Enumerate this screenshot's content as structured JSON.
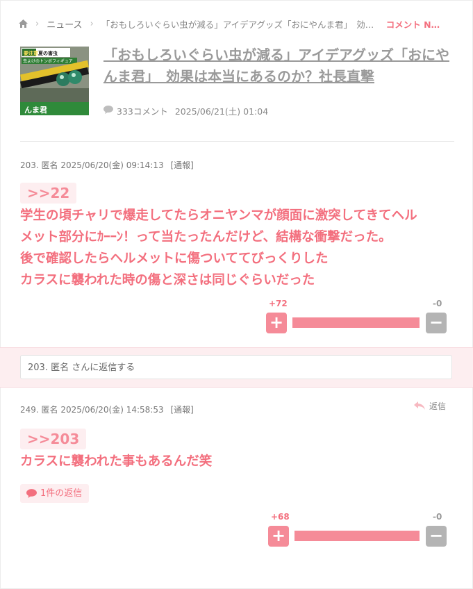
{
  "breadcrumb": {
    "home_icon": "home-icon",
    "news": "ニュース",
    "article": "「おもしろいぐらい虫が減る」アイデアグッズ「おにやんま君」　効果は本当にあるのか？社長直撃",
    "comments": "コメント N…"
  },
  "article": {
    "thumb_text_top": "要注意",
    "thumb_text_top2": "夏の害虫",
    "thumb_text_mid": "虫よけのトンボフィギュア",
    "thumb_text_bottom": "んま君",
    "title": "「おもしろいぐらい虫が減る」アイデアグッズ「おにやんま君」　効果は本当にあるのか？社長直撃",
    "comment_count": "333コメント",
    "date": "2025/06/21(土) 01:04"
  },
  "comments": [
    {
      "number": "203.",
      "author": "匿名",
      "datetime": "2025/06/20(金) 09:14:13",
      "report": "[通報]",
      "anchor": ">>22",
      "lines": [
        "学生の頃チャリで爆走してたらオニヤンマが顔面に激突してきてヘル",
        "メット部分にｶｰｰﾝ！って当たったんだけど、結構な衝撃だった。",
        "後で確認したらヘルメットに傷ついててびっくりした",
        "カラスに襲われた時の傷と深さは同じぐらいだった"
      ],
      "plus": "+72",
      "minus": "-0",
      "plus_ratio": 1.0
    },
    {
      "number": "249.",
      "author": "匿名",
      "datetime": "2025/06/20(金) 14:58:53",
      "report": "[通報]",
      "reply_label": "返信",
      "anchor": ">>203",
      "lines": [
        "カラスに襲われた事もあるんだ笑"
      ],
      "replies": "1件の返信",
      "plus": "+68",
      "minus": "-0",
      "plus_ratio": 1.0
    }
  ],
  "reply_box": {
    "placeholder": "203. 匿名 さんに返信する"
  },
  "vote_buttons": {
    "plus": "+",
    "minus": "−"
  }
}
